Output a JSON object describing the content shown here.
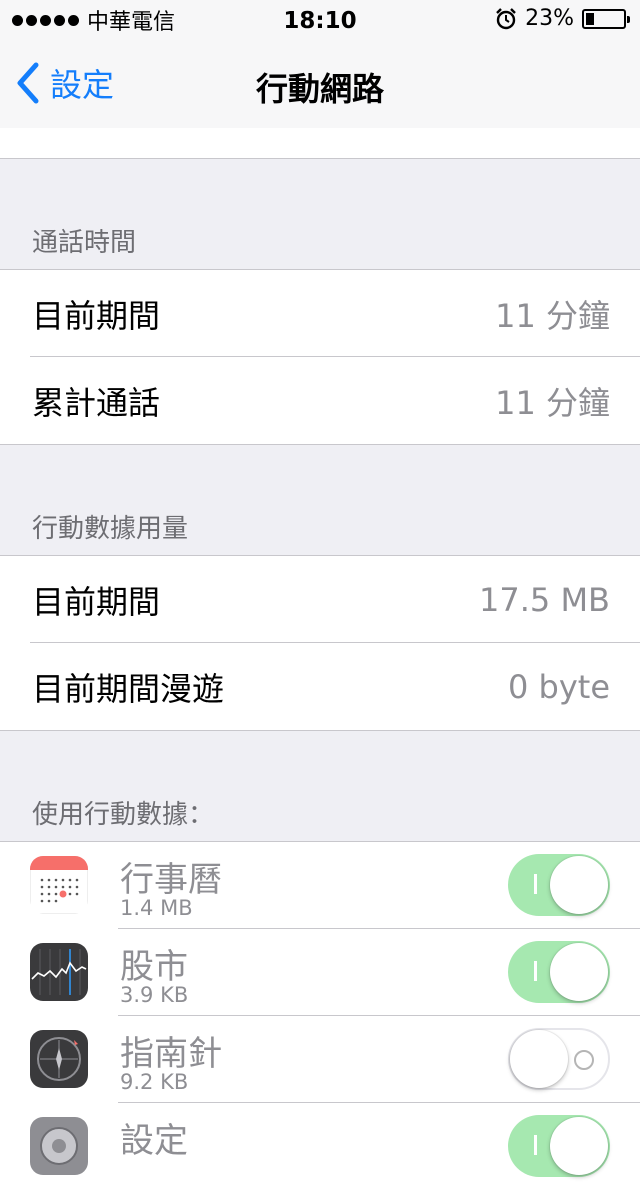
{
  "status_bar": {
    "carrier": "中華電信",
    "time": "18:10",
    "battery_percent_text": "23%",
    "battery_level": 0.23,
    "signal_bars": 5
  },
  "nav": {
    "back_label": "設定",
    "title": "行動網路"
  },
  "sections": {
    "call_time": {
      "header": "通話時間",
      "rows": [
        {
          "label": "目前期間",
          "value": "11 分鐘"
        },
        {
          "label": "累計通話",
          "value": "11 分鐘"
        }
      ]
    },
    "data_usage": {
      "header": "行動數據用量",
      "rows": [
        {
          "label": "目前期間",
          "value": "17.5 MB"
        },
        {
          "label": "目前期間漫遊",
          "value": "0 byte"
        }
      ]
    },
    "apps": {
      "header": "使用行動數據：",
      "items": [
        {
          "name": "行事曆",
          "usage": "1.4 MB",
          "enabled": true,
          "icon": "calendar-icon"
        },
        {
          "name": "股市",
          "usage": "3.9 KB",
          "enabled": true,
          "icon": "stocks-icon"
        },
        {
          "name": "指南針",
          "usage": "9.2 KB",
          "enabled": false,
          "icon": "compass-icon"
        },
        {
          "name": "設定",
          "usage": "",
          "enabled": true,
          "icon": "settings-icon"
        }
      ]
    }
  },
  "colors": {
    "accent": "#147efb",
    "toggle_on": "#a6e8b0",
    "background": "#efeff4",
    "secondary_text": "#8e8e93"
  }
}
